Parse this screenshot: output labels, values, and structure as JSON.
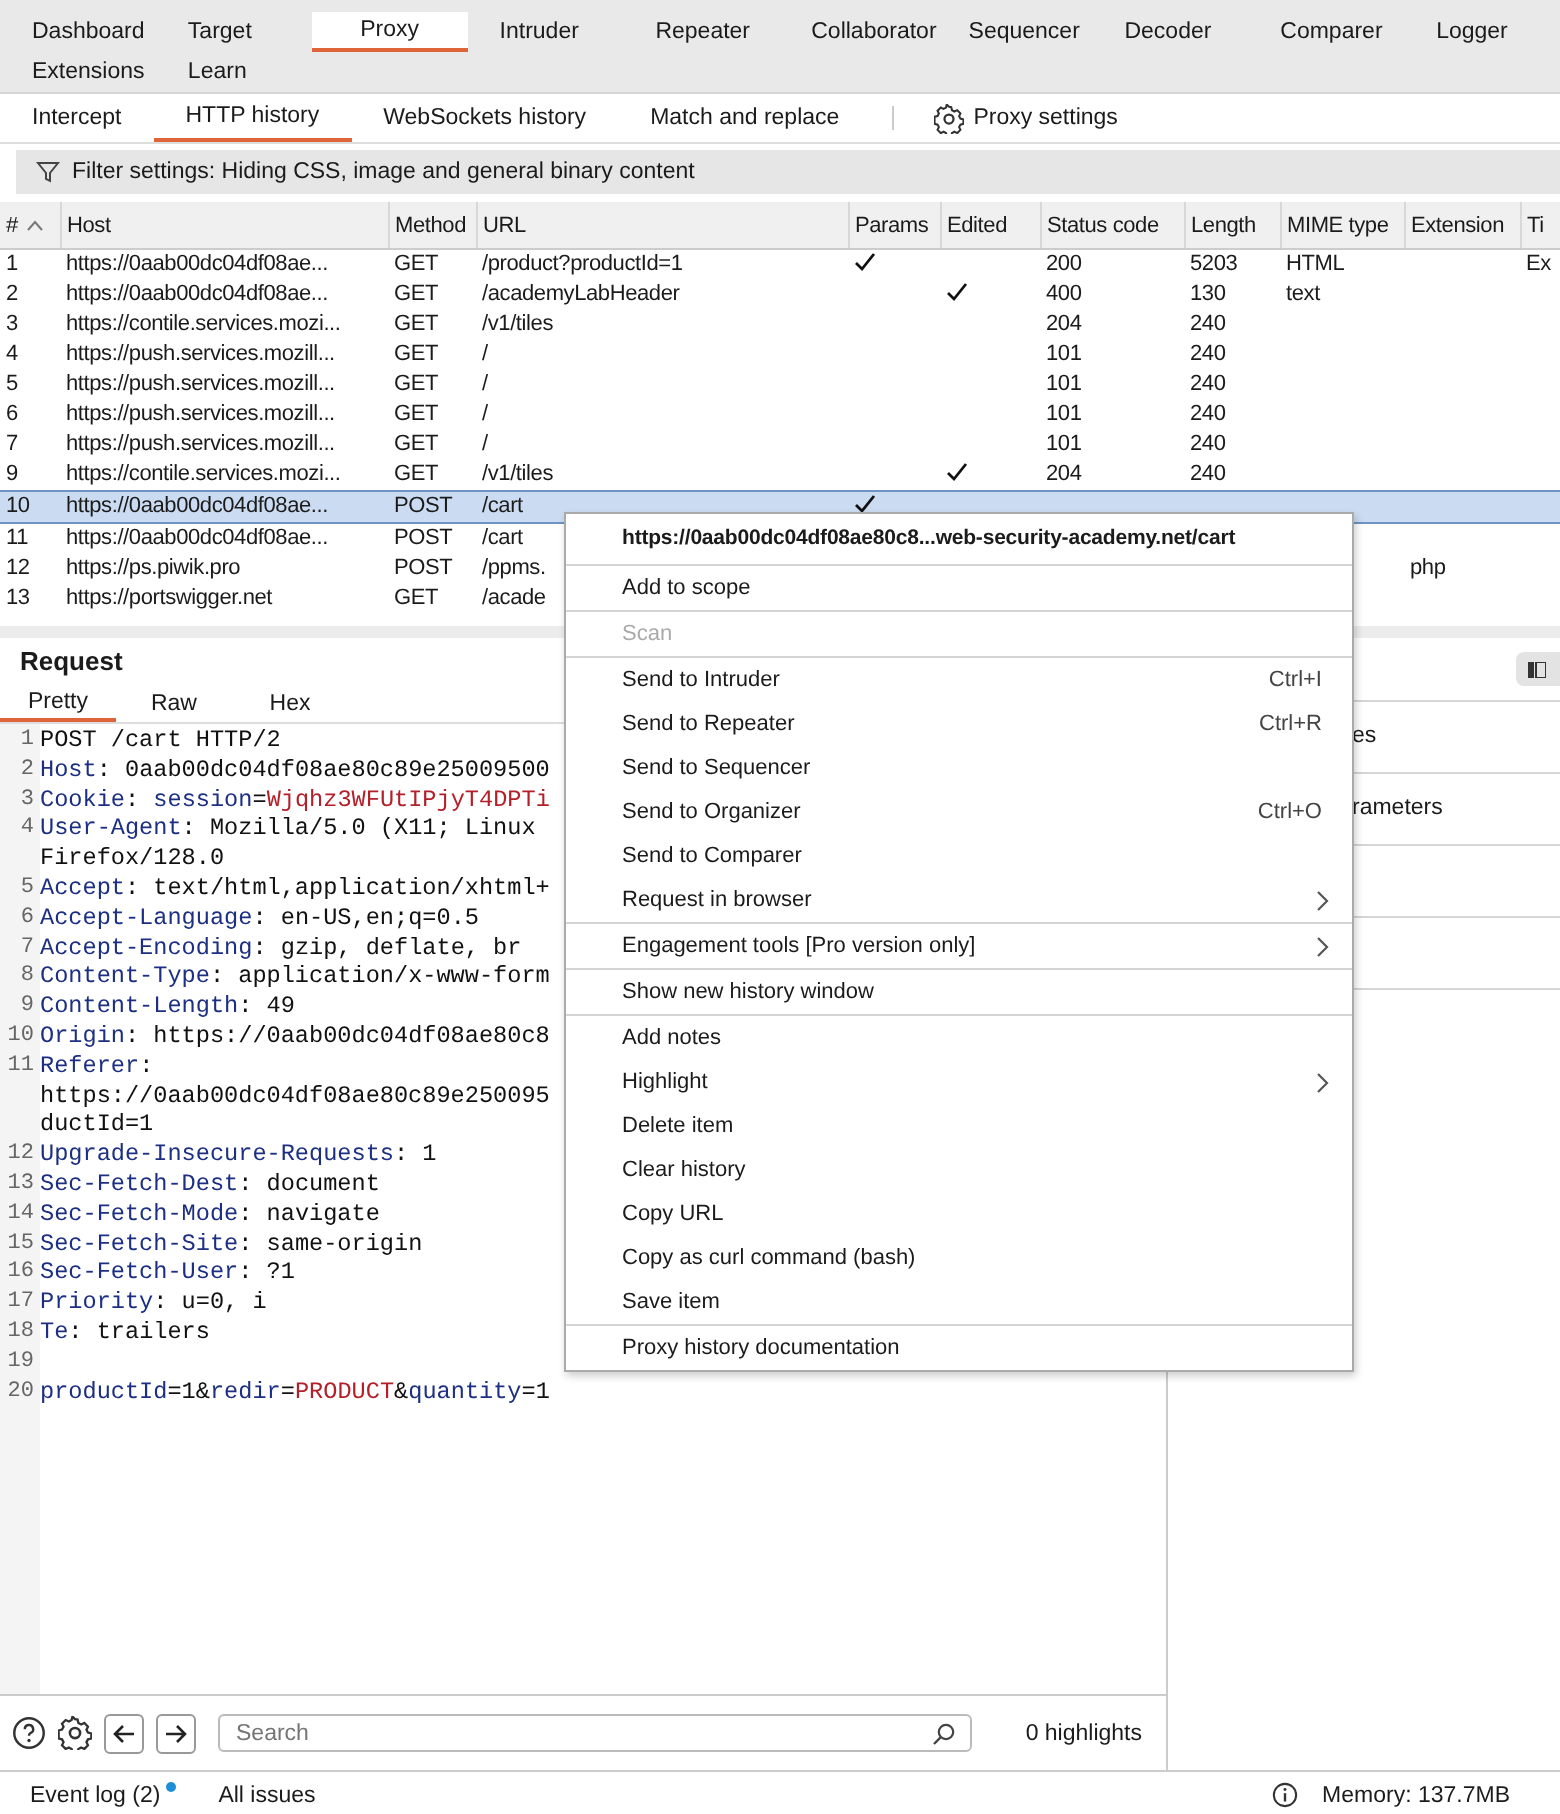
{
  "main_tabs": [
    {
      "label": "Dashboard",
      "selected": false
    },
    {
      "label": "Target",
      "selected": false
    },
    {
      "label": "Proxy",
      "selected": true
    },
    {
      "label": "Intruder",
      "selected": false
    },
    {
      "label": "Repeater",
      "selected": false
    },
    {
      "label": "Collaborator",
      "selected": false
    },
    {
      "label": "Sequencer",
      "selected": false
    },
    {
      "label": "Decoder",
      "selected": false
    },
    {
      "label": "Comparer",
      "selected": false
    },
    {
      "label": "Logger",
      "selected": false
    },
    {
      "label": "Extensions",
      "selected": false
    },
    {
      "label": "Learn",
      "selected": false
    }
  ],
  "sub_tabs": [
    {
      "label": "Intercept",
      "selected": false
    },
    {
      "label": "HTTP history",
      "selected": true
    },
    {
      "label": "WebSockets history",
      "selected": false
    },
    {
      "label": "Match and replace",
      "selected": false
    }
  ],
  "proxy_settings": "Proxy settings",
  "filter": "Filter settings: Hiding CSS, image and general binary content",
  "table": {
    "columns": [
      "#",
      "Host",
      "Method",
      "URL",
      "Params",
      "Edited",
      "Status code",
      "Length",
      "MIME type",
      "Extension",
      "Ti"
    ],
    "rows": [
      {
        "num": "1",
        "host": "https://0aab00dc04df08ae...",
        "method": "GET",
        "url": "/product?productId=1",
        "params": true,
        "edited": false,
        "status": "200",
        "length": "5203",
        "mime": "HTML",
        "column_11": "Ex",
        "selected": false
      },
      {
        "num": "2",
        "host": "https://0aab00dc04df08ae...",
        "method": "GET",
        "url": "/academyLabHeader",
        "params": false,
        "edited": true,
        "status": "400",
        "length": "130",
        "mime": "text",
        "selected": false
      },
      {
        "num": "3",
        "host": "https://contile.services.mozi...",
        "method": "GET",
        "url": "/v1/tiles",
        "params": false,
        "edited": false,
        "status": "204",
        "length": "240",
        "selected": false
      },
      {
        "num": "4",
        "host": "https://push.services.mozill...",
        "method": "GET",
        "url": "/",
        "params": false,
        "edited": false,
        "status": "101",
        "length": "240",
        "selected": false
      },
      {
        "num": "5",
        "host": "https://push.services.mozill...",
        "method": "GET",
        "url": "/",
        "params": false,
        "edited": false,
        "status": "101",
        "length": "240",
        "selected": false
      },
      {
        "num": "6",
        "host": "https://push.services.mozill...",
        "method": "GET",
        "url": "/",
        "params": false,
        "edited": false,
        "status": "101",
        "length": "240",
        "selected": false
      },
      {
        "num": "7",
        "host": "https://push.services.mozill...",
        "method": "GET",
        "url": "/",
        "params": false,
        "edited": false,
        "status": "101",
        "length": "240",
        "selected": false
      },
      {
        "num": "9",
        "host": "https://contile.services.mozi...",
        "method": "GET",
        "url": "/v1/tiles",
        "params": false,
        "edited": true,
        "status": "204",
        "length": "240",
        "selected": false
      },
      {
        "num": "10",
        "host": "https://0aab00dc04df08ae...",
        "method": "POST",
        "url": "/cart",
        "params": true,
        "edited": false,
        "selected": true
      },
      {
        "num": "11",
        "host": "https://0aab00dc04df08ae...",
        "method": "POST",
        "url": "/cart",
        "selected": false
      },
      {
        "num": "12",
        "host": "https://ps.piwik.pro",
        "method": "POST",
        "url": "/ppms.",
        "extension": "php",
        "selected": false
      },
      {
        "num": "13",
        "host": "https://portswigger.net",
        "method": "GET",
        "url": "/acade",
        "selected": false
      }
    ]
  },
  "request": {
    "title": "Request",
    "tabs": [
      {
        "label": "Pretty",
        "selected": true
      },
      {
        "label": "Raw",
        "selected": false
      },
      {
        "label": "Hex",
        "selected": false
      }
    ],
    "lines": [
      {
        "number": "1",
        "parts": [
          {
            "kind": "plain",
            "text": "POST /cart HTTP/2"
          }
        ]
      },
      {
        "number": "2",
        "parts": [
          {
            "kind": "name",
            "text": "Host"
          },
          {
            "kind": "plain",
            "text": ": 0aab00dc04df08ae80c89e25009500"
          }
        ]
      },
      {
        "number": "3",
        "parts": [
          {
            "kind": "name",
            "text": "Cookie"
          },
          {
            "kind": "plain",
            "text": ": "
          },
          {
            "kind": "name",
            "text": "session"
          },
          {
            "kind": "plain",
            "text": "="
          },
          {
            "kind": "value",
            "text": "Wjqhz3WFUtIPjyT4DPTi"
          }
        ]
      },
      {
        "number": "4",
        "parts": [
          {
            "kind": "name",
            "text": "User-Agent"
          },
          {
            "kind": "plain",
            "text": ": Mozilla/5.0 (X11; Linux"
          }
        ]
      },
      {
        "parts": [
          {
            "kind": "plain",
            "text": "Firefox/128.0"
          }
        ]
      },
      {
        "number": "5",
        "parts": [
          {
            "kind": "name",
            "text": "Accept"
          },
          {
            "kind": "plain",
            "text": ": text/html,application/xhtml+"
          }
        ]
      },
      {
        "number": "6",
        "parts": [
          {
            "kind": "name",
            "text": "Accept-Language"
          },
          {
            "kind": "plain",
            "text": ": en-US,en;q=0.5"
          }
        ]
      },
      {
        "number": "7",
        "parts": [
          {
            "kind": "name",
            "text": "Accept-Encoding"
          },
          {
            "kind": "plain",
            "text": ": gzip, deflate, br"
          }
        ]
      },
      {
        "number": "8",
        "parts": [
          {
            "kind": "name",
            "text": "Content-Type"
          },
          {
            "kind": "plain",
            "text": ": application/x-www-form"
          }
        ]
      },
      {
        "number": "9",
        "parts": [
          {
            "kind": "name",
            "text": "Content-Length"
          },
          {
            "kind": "plain",
            "text": ": 49"
          }
        ]
      },
      {
        "number": "10",
        "parts": [
          {
            "kind": "name",
            "text": "Origin"
          },
          {
            "kind": "plain",
            "text": ": https://0aab00dc04df08ae80c8"
          }
        ]
      },
      {
        "number": "11",
        "parts": [
          {
            "kind": "name",
            "text": "Referer"
          },
          {
            "kind": "plain",
            "text": ":"
          }
        ]
      },
      {
        "parts": [
          {
            "kind": "plain",
            "text": "https://0aab00dc04df08ae80c89e250095"
          }
        ]
      },
      {
        "parts": [
          {
            "kind": "plain",
            "text": "ductId=1"
          }
        ]
      },
      {
        "number": "12",
        "parts": [
          {
            "kind": "name",
            "text": "Upgrade-Insecure-Requests"
          },
          {
            "kind": "plain",
            "text": ": 1"
          }
        ]
      },
      {
        "number": "13",
        "parts": [
          {
            "kind": "name",
            "text": "Sec-Fetch-Dest"
          },
          {
            "kind": "plain",
            "text": ": document"
          }
        ]
      },
      {
        "number": "14",
        "parts": [
          {
            "kind": "name",
            "text": "Sec-Fetch-Mode"
          },
          {
            "kind": "plain",
            "text": ": navigate"
          }
        ]
      },
      {
        "number": "15",
        "parts": [
          {
            "kind": "name",
            "text": "Sec-Fetch-Site"
          },
          {
            "kind": "plain",
            "text": ": same-origin"
          }
        ]
      },
      {
        "number": "16",
        "parts": [
          {
            "kind": "name",
            "text": "Sec-Fetch-User"
          },
          {
            "kind": "plain",
            "text": ": ?1"
          }
        ]
      },
      {
        "number": "17",
        "parts": [
          {
            "kind": "name",
            "text": "Priority"
          },
          {
            "kind": "plain",
            "text": ": u=0, i"
          }
        ]
      },
      {
        "number": "18",
        "parts": [
          {
            "kind": "name",
            "text": "Te"
          },
          {
            "kind": "plain",
            "text": ": trailers"
          }
        ]
      },
      {
        "number": "19"
      },
      {
        "number": "20",
        "parts": [
          {
            "kind": "name",
            "text": "productId"
          },
          {
            "kind": "plain",
            "text": "=1&"
          },
          {
            "kind": "name",
            "text": "redir"
          },
          {
            "kind": "plain",
            "text": "="
          },
          {
            "kind": "value",
            "text": "PRODUCT"
          },
          {
            "kind": "plain",
            "text": "&"
          },
          {
            "kind": "name",
            "text": "quantity"
          },
          {
            "kind": "plain",
            "text": "=1"
          }
        ]
      }
    ],
    "search": {
      "placeholder": "Search"
    },
    "highlights": "0 highlights"
  },
  "inspector": {
    "rows": [
      "es",
      "rameters"
    ]
  },
  "context_menu": [
    {
      "kind": "header",
      "label": "https://0aab00dc04df08ae80c8...web-security-academy.net/cart"
    },
    {
      "kind": "item",
      "label": "Add to scope",
      "divider_above": true,
      "disabled": false
    },
    {
      "kind": "item",
      "label": "Scan",
      "divider_above": true,
      "disabled": true
    },
    {
      "kind": "item",
      "label": "Send to Intruder",
      "shortcut": "Ctrl+I",
      "divider_above": true,
      "disabled": false
    },
    {
      "kind": "item",
      "label": "Send to Repeater",
      "shortcut": "Ctrl+R",
      "divider_above": false,
      "disabled": false
    },
    {
      "kind": "item",
      "label": "Send to Sequencer",
      "divider_above": false,
      "disabled": false
    },
    {
      "kind": "item",
      "label": "Send to Organizer",
      "shortcut": "Ctrl+O",
      "divider_above": false,
      "disabled": false
    },
    {
      "kind": "item",
      "label": "Send to Comparer",
      "divider_above": false,
      "disabled": false
    },
    {
      "kind": "submenu",
      "label": "Request in browser",
      "divider_above": false,
      "disabled": false
    },
    {
      "kind": "submenu",
      "label": "Engagement tools [Pro version only]",
      "divider_above": true,
      "disabled": false
    },
    {
      "kind": "item",
      "label": "Show new history window",
      "divider_above": true,
      "disabled": false
    },
    {
      "kind": "item",
      "label": "Add notes",
      "divider_above": true,
      "disabled": false
    },
    {
      "kind": "submenu",
      "label": "Highlight",
      "divider_above": false,
      "disabled": false
    },
    {
      "kind": "item",
      "label": "Delete item",
      "divider_above": false,
      "disabled": false
    },
    {
      "kind": "item",
      "label": "Clear history",
      "divider_above": false,
      "disabled": false
    },
    {
      "kind": "item",
      "label": "Copy URL",
      "divider_above": false,
      "disabled": false
    },
    {
      "kind": "item",
      "label": "Copy as curl command (bash)",
      "divider_above": false,
      "disabled": false
    },
    {
      "kind": "item",
      "label": "Save item",
      "divider_above": false,
      "disabled": false
    },
    {
      "kind": "item",
      "label": "Proxy history documentation",
      "divider_above": true,
      "disabled": false
    }
  ],
  "status_bar": {
    "event_log": "Event log (2)",
    "event_log_unread": true,
    "all_issues": "All issues",
    "memory": "Memory: 137.7MB"
  }
}
